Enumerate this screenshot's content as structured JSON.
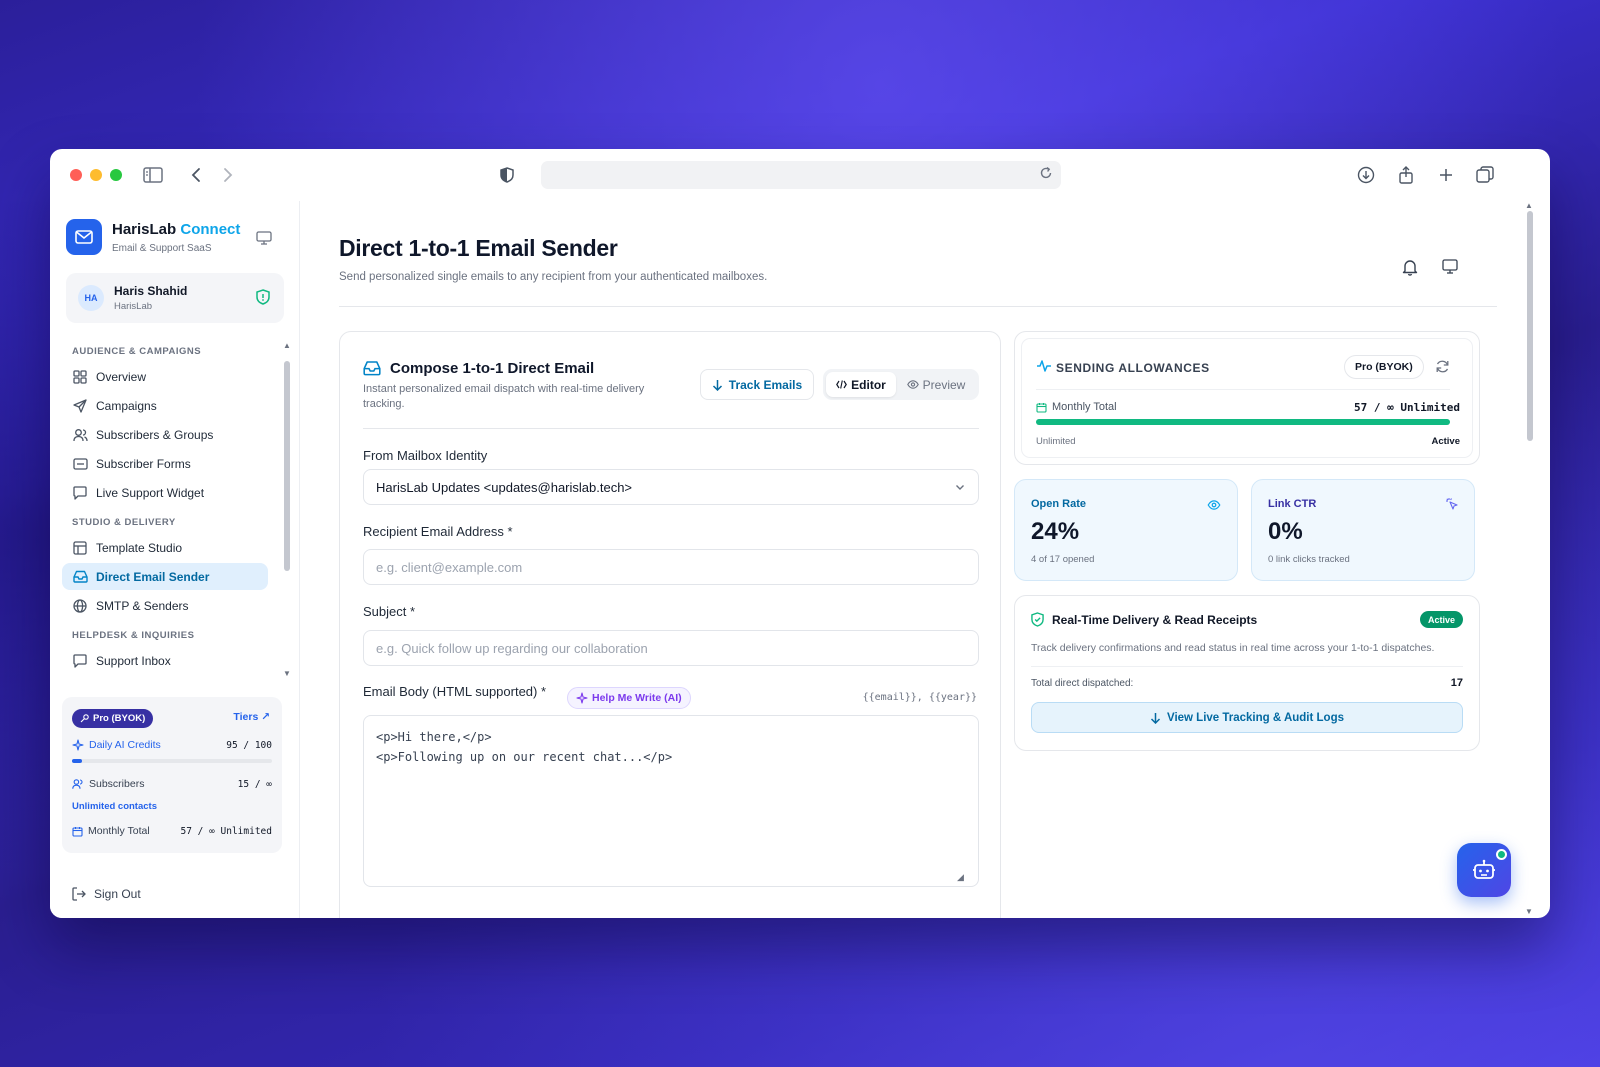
{
  "app": {
    "brand_name": "HarisLab",
    "brand_accent": "Connect",
    "brand_sub": "Email & Support SaaS"
  },
  "user": {
    "initials": "HA",
    "name": "Haris Shahid",
    "org": "HarisLab"
  },
  "sidebar": {
    "sections": [
      {
        "title": "AUDIENCE & CAMPAIGNS",
        "items": [
          {
            "label": "Overview",
            "icon": "grid-icon"
          },
          {
            "label": "Campaigns",
            "icon": "send-icon"
          },
          {
            "label": "Subscribers & Groups",
            "icon": "users-icon"
          },
          {
            "label": "Subscriber Forms",
            "icon": "form-icon"
          },
          {
            "label": "Live Support Widget",
            "icon": "chat-icon"
          }
        ]
      },
      {
        "title": "STUDIO & DELIVERY",
        "items": [
          {
            "label": "Template Studio",
            "icon": "layout-icon"
          },
          {
            "label": "Direct Email Sender",
            "icon": "inbox-icon",
            "active": true
          },
          {
            "label": "SMTP & Senders",
            "icon": "globe-icon"
          }
        ]
      },
      {
        "title": "HELPDESK & INQUIRIES",
        "items": [
          {
            "label": "Support Inbox",
            "icon": "chat-icon"
          }
        ]
      }
    ]
  },
  "plan": {
    "badge": "Pro (BYOK)",
    "tiers_link": "Tiers ↗",
    "credits_label": "Daily AI Credits",
    "credits_value": "95 / 100",
    "credits_fraction": 0.05,
    "subscribers_label": "Subscribers",
    "subscribers_value": "15 / ∞",
    "unlimited_contacts": "Unlimited contacts",
    "monthly_label": "Monthly Total",
    "monthly_value": "57 / ∞ Unlimited"
  },
  "sign_out": "Sign Out",
  "page": {
    "title": "Direct 1-to-1 Email Sender",
    "subtitle": "Send personalized single emails to any recipient from your authenticated mailboxes."
  },
  "compose": {
    "title": "Compose 1-to-1 Direct Email",
    "subtitle": "Instant personalized email dispatch with real-time delivery tracking.",
    "track_button": "Track Emails",
    "editor_tab": "Editor",
    "preview_tab": "Preview",
    "from_label": "From Mailbox Identity",
    "from_value": "HarisLab Updates <updates@harislab.tech>",
    "recipient_label": "Recipient Email Address *",
    "recipient_placeholder": "e.g. client@example.com",
    "subject_label": "Subject *",
    "subject_placeholder": "e.g. Quick follow up regarding our collaboration",
    "body_label": "Email Body (HTML supported) *",
    "ai_button": "Help Me Write (AI)",
    "vars_hint": "{{email}}, {{year}}",
    "body_value": "<p>Hi there,</p>\n<p>Following up on our recent chat...</p>"
  },
  "allowances": {
    "title": "SENDING ALLOWANCES",
    "plan_pill": "Pro (BYOK)",
    "monthly_label": "Monthly Total",
    "monthly_value": "57 / ∞ Unlimited",
    "bar_fraction": 1.0,
    "bar_left_label": "Unlimited",
    "bar_right_label": "Active"
  },
  "stats": {
    "open_rate_label": "Open Rate",
    "open_rate_value": "24%",
    "open_rate_note": "4 of 17 opened",
    "ctr_label": "Link CTR",
    "ctr_value": "0%",
    "ctr_note": "0 link clicks tracked"
  },
  "receipts": {
    "title": "Real-Time Delivery & Read Receipts",
    "badge": "Active",
    "description": "Track delivery confirmations and read status in real time across your 1-to-1 dispatches.",
    "total_label": "Total direct dispatched:",
    "total_value": "17",
    "button": "View Live Tracking & Audit Logs"
  },
  "colors": {
    "primary": "#2563eb",
    "accent": "#0ea5e9",
    "success": "#10b981",
    "ai": "#7c3aed"
  }
}
